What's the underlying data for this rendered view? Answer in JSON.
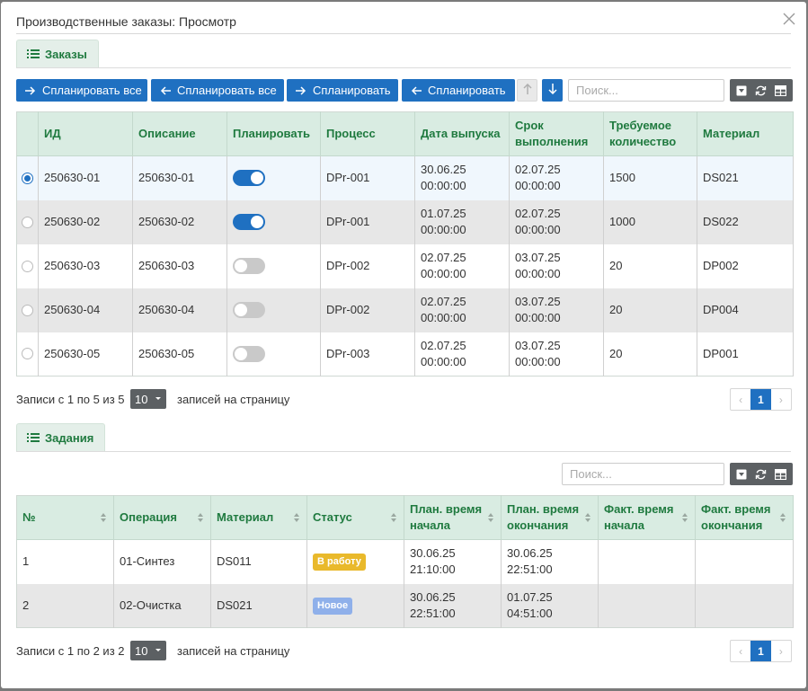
{
  "dialog": {
    "title": "Производственные заказы: Просмотр"
  },
  "orders": {
    "tab_label": "Заказы",
    "toolbar": {
      "schedule_all": "Спланировать все",
      "unschedule_all": "Спланировать все",
      "schedule": "Спланировать",
      "unschedule": "Спланировать",
      "search_placeholder": "Поиск..."
    },
    "columns": [
      "ИД",
      "Описание",
      "Планировать",
      "Процесс",
      "Дата выпуска",
      "Срок выполнения",
      "Требуемое количество",
      "Материал"
    ],
    "rows": [
      {
        "selected": true,
        "id": "250630-01",
        "desc": "250630-01",
        "plan": true,
        "process": "DPr-001",
        "date1": "30.06.25",
        "time1": "00:00:00",
        "date2": "02.07.25",
        "time2": "00:00:00",
        "qty": "1500",
        "material": "DS021"
      },
      {
        "selected": false,
        "id": "250630-02",
        "desc": "250630-02",
        "plan": true,
        "process": "DPr-001",
        "date1": "01.07.25",
        "time1": "00:00:00",
        "date2": "02.07.25",
        "time2": "00:00:00",
        "qty": "1000",
        "material": "DS022"
      },
      {
        "selected": false,
        "id": "250630-03",
        "desc": "250630-03",
        "plan": false,
        "process": "DPr-002",
        "date1": "02.07.25",
        "time1": "00:00:00",
        "date2": "03.07.25",
        "time2": "00:00:00",
        "qty": "20",
        "material": "DP002"
      },
      {
        "selected": false,
        "id": "250630-04",
        "desc": "250630-04",
        "plan": false,
        "process": "DPr-002",
        "date1": "02.07.25",
        "time1": "00:00:00",
        "date2": "03.07.25",
        "time2": "00:00:00",
        "qty": "20",
        "material": "DP004"
      },
      {
        "selected": false,
        "id": "250630-05",
        "desc": "250630-05",
        "plan": false,
        "process": "DPr-003",
        "date1": "02.07.25",
        "time1": "00:00:00",
        "date2": "03.07.25",
        "time2": "00:00:00",
        "qty": "20",
        "material": "DP001"
      }
    ],
    "footer": {
      "records": "Записи с 1 по 5 из 5",
      "page_size": "10",
      "per_page": "записей на страницу",
      "current_page": "1"
    }
  },
  "tasks": {
    "tab_label": "Задания",
    "search_placeholder": "Поиск...",
    "columns": [
      "№",
      "Операция",
      "Материал",
      "Статус",
      "План. время начала",
      "План. время окончания",
      "Факт. время начала",
      "Факт. время окончания"
    ],
    "rows": [
      {
        "num": "1",
        "op": "01-Синтез",
        "material": "DS011",
        "status": "В работу",
        "status_color": "#e9b92b",
        "ps_date": "30.06.25",
        "ps_time": "21:10:00",
        "pe_date": "30.06.25",
        "pe_time": "22:51:00",
        "fs": "",
        "fe": ""
      },
      {
        "num": "2",
        "op": "02-Очистка",
        "material": "DS021",
        "status": "Новое",
        "status_color": "#8fb0ea",
        "ps_date": "30.06.25",
        "ps_time": "22:51:00",
        "pe_date": "01.07.25",
        "pe_time": "04:51:00",
        "fs": "",
        "fe": ""
      }
    ],
    "footer": {
      "records": "Записи с 1 по 2 из 2",
      "page_size": "10",
      "per_page": "записей на страницу",
      "current_page": "1"
    }
  }
}
